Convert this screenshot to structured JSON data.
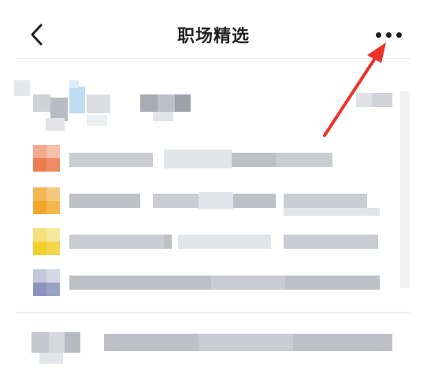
{
  "header": {
    "title": "职场精选",
    "back_icon": "chevron-left-icon",
    "more_icon": "more-horizontal-icon"
  },
  "annotation": {
    "arrow_color": "#f0312b"
  },
  "content": {
    "pixelated": true,
    "rows": [
      {
        "icon_color": "#ee7a4f"
      },
      {
        "icon_color": "#f3a52c"
      },
      {
        "icon_color": "#f2cf2a"
      },
      {
        "icon_color": "#8a93bd"
      }
    ]
  }
}
